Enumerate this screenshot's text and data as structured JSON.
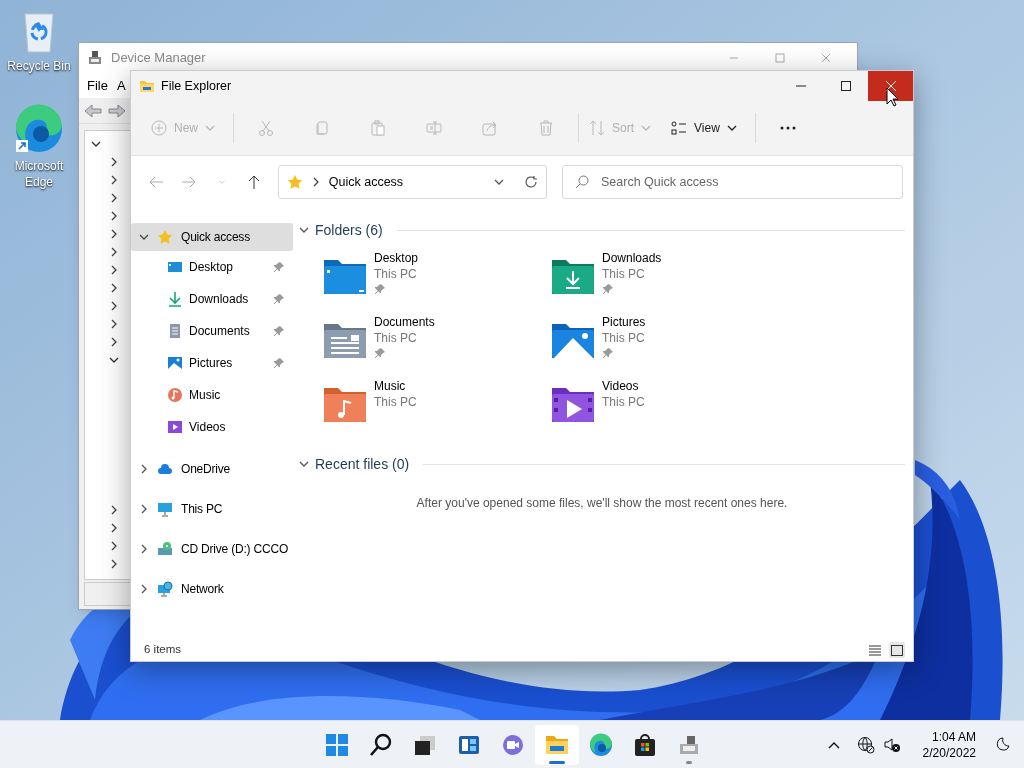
{
  "desktop_icons": [
    {
      "label": "Recycle Bin"
    },
    {
      "label": "Microsoft Edge"
    }
  ],
  "device_manager": {
    "title": "Device Manager",
    "menu": [
      "File",
      "A"
    ],
    "tree_top": [
      {
        "expanded": true
      },
      {
        "expanded": false
      },
      {
        "expanded": false
      },
      {
        "expanded": false
      },
      {
        "expanded": false
      },
      {
        "expanded": false
      },
      {
        "expanded": false
      },
      {
        "expanded": false
      },
      {
        "expanded": false
      },
      {
        "expanded": false
      },
      {
        "expanded": false
      },
      {
        "expanded": false
      },
      {
        "expanded": true
      }
    ],
    "tree_bottom": [
      {
        "expanded": false
      },
      {
        "expanded": false
      },
      {
        "expanded": false
      },
      {
        "expanded": false
      }
    ]
  },
  "file_explorer": {
    "title": "File Explorer",
    "close_hovered": true,
    "commands": [
      {
        "kind": "labeled",
        "label": "New",
        "disabled": true
      },
      {
        "kind": "icon",
        "disabled": true
      },
      {
        "kind": "icon",
        "disabled": true
      },
      {
        "kind": "icon",
        "disabled": true
      },
      {
        "kind": "icon",
        "disabled": true
      },
      {
        "kind": "icon",
        "disabled": true
      },
      {
        "kind": "icon",
        "disabled": true
      },
      {
        "kind": "labeled",
        "label": "Sort",
        "disabled": true
      },
      {
        "kind": "labeled",
        "label": "View",
        "disabled": false
      },
      {
        "kind": "icon",
        "disabled": false
      }
    ],
    "nav": [
      {
        "disabled": true
      },
      {
        "disabled": true
      },
      {
        "disabled": true
      },
      {
        "disabled": false
      }
    ],
    "address": "Quick access",
    "search": {
      "placeholder": "Search Quick access"
    },
    "sidebar": [
      {
        "label": "Quick access",
        "selected": true,
        "expanded": true,
        "children": [
          {
            "label": "Desktop",
            "selected": false,
            "pinned": true
          },
          {
            "label": "Downloads",
            "selected": false,
            "pinned": true
          },
          {
            "label": "Documents",
            "selected": false,
            "pinned": true
          },
          {
            "label": "Pictures",
            "selected": false,
            "pinned": true
          },
          {
            "label": "Music",
            "selected": false,
            "pinned": false
          },
          {
            "label": "Videos",
            "selected": false,
            "pinned": false
          }
        ]
      },
      {
        "label": "OneDrive",
        "selected": false,
        "expanded": false
      },
      {
        "label": "This PC",
        "selected": false,
        "expanded": false
      },
      {
        "label": "CD Drive (D:) CCCO",
        "selected": false,
        "expanded": false
      },
      {
        "label": "Network",
        "selected": false,
        "expanded": false
      }
    ],
    "sections": [
      {
        "title": "Folders (6)",
        "expanded": true,
        "folders": [
          {
            "name": "Desktop",
            "location": "This PC",
            "pinned": true
          },
          {
            "name": "Downloads",
            "location": "This PC",
            "pinned": true
          },
          {
            "name": "Documents",
            "location": "This PC",
            "pinned": true
          },
          {
            "name": "Pictures",
            "location": "This PC",
            "pinned": true
          },
          {
            "name": "Music",
            "location": "This PC",
            "pinned": false
          },
          {
            "name": "Videos",
            "location": "This PC",
            "pinned": false
          }
        ]
      },
      {
        "title": "Recent files (0)",
        "expanded": true,
        "message": "After you've opened some files, we'll show the most recent ones here."
      }
    ],
    "status": "6 items",
    "view_toggles": [
      {
        "selected": false
      },
      {
        "selected": true
      }
    ]
  },
  "taskbar": {
    "apps": [
      {
        "active": false,
        "running": false
      },
      {
        "active": false,
        "running": false
      },
      {
        "active": false,
        "running": false
      },
      {
        "active": false,
        "running": false
      },
      {
        "active": false,
        "running": false
      },
      {
        "active": true,
        "running": true
      },
      {
        "active": false,
        "running": false
      },
      {
        "active": false,
        "running": false
      },
      {
        "active": false,
        "running": true
      }
    ],
    "time": "1:04 AM",
    "date": "2/20/2022"
  }
}
